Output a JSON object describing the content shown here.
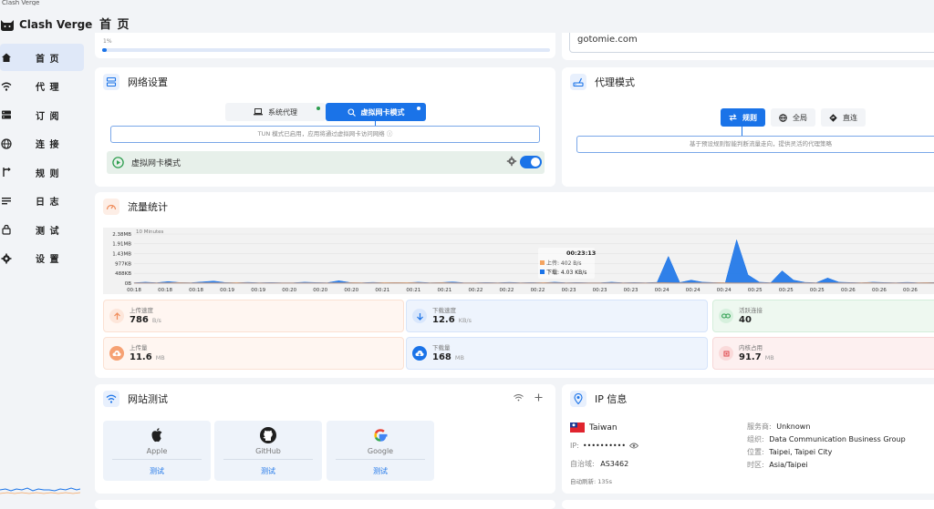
{
  "window": {
    "title": "Clash Verge"
  },
  "brand": {
    "name": "Clash Verge"
  },
  "header": {
    "title": "首 页"
  },
  "nav": [
    {
      "label": "首 页",
      "icon": "home-icon",
      "active": true
    },
    {
      "label": "代 理",
      "icon": "wifi-icon",
      "active": false
    },
    {
      "label": "订 阅",
      "icon": "subscription-icon",
      "active": false
    },
    {
      "label": "连 接",
      "icon": "globe-icon",
      "active": false
    },
    {
      "label": "规 则",
      "icon": "rules-icon",
      "active": false
    },
    {
      "label": "日 志",
      "icon": "log-icon",
      "active": false
    },
    {
      "label": "测 试",
      "icon": "lock-icon",
      "active": false
    },
    {
      "label": "设 置",
      "icon": "gear-icon",
      "active": false
    }
  ],
  "profile": {
    "progress_label": "1%",
    "progress": 0.01
  },
  "site": {
    "current": "gotomie.com"
  },
  "network": {
    "title": "网络设置",
    "system_proxy_label": "系统代理",
    "tun_label": "虚拟网卡模式",
    "hint": "TUN 模式已启用，应用将通过虚拟网卡访问网络 ⓘ",
    "tun_row_label": "虚拟网卡模式",
    "tun_enabled": true
  },
  "proxy_mode": {
    "title": "代理模式",
    "modes": [
      "规则",
      "全局",
      "直连"
    ],
    "active": "规则",
    "hint": "基于预设规则智能判断流量走向，提供灵活的代理策略"
  },
  "traffic": {
    "title": "流量统计",
    "range_label": "10 Minutes",
    "tooltip": {
      "time": "00:23:13",
      "up_label": "上传",
      "up_value": "402 B/s",
      "down_label": "下载",
      "down_value": "4.03 KB/s"
    },
    "stats": [
      {
        "title": "上传速度",
        "value": "786",
        "unit": "B/s",
        "icon": "arrow-up-icon"
      },
      {
        "title": "下载速度",
        "value": "12.6",
        "unit": "KB/s",
        "icon": "arrow-down-icon"
      },
      {
        "title": "活跃连接",
        "value": "40",
        "unit": "",
        "icon": "link-icon"
      },
      {
        "title": "上传量",
        "value": "11.6",
        "unit": "MB",
        "icon": "cloud-upload-icon"
      },
      {
        "title": "下载量",
        "value": "168",
        "unit": "MB",
        "icon": "cloud-download-icon"
      },
      {
        "title": "内核占用",
        "value": "91.7",
        "unit": "MB",
        "icon": "memory-icon"
      }
    ]
  },
  "chart_data": {
    "type": "area",
    "title": "10 Minutes",
    "y_ticks": [
      "2.38MB",
      "1.91MB",
      "1.43MB",
      "977KB",
      "488KB",
      "0B"
    ],
    "y_tick_values": [
      2.38,
      1.91,
      1.43,
      0.954,
      0.477,
      0
    ],
    "ylim": [
      0,
      2.38
    ],
    "x_ticks": [
      "00:18",
      "00:18",
      "00:18",
      "00:19",
      "00:19",
      "00:20",
      "00:20",
      "00:20",
      "00:21",
      "00:21",
      "00:21",
      "00:22",
      "00:22",
      "00:22",
      "00:23",
      "00:23",
      "00:23",
      "00:24",
      "00:24",
      "00:24",
      "00:25",
      "00:25",
      "00:25",
      "00:26",
      "00:26",
      "00:26",
      "00:27"
    ],
    "series": [
      {
        "name": "上传",
        "color": "#f4a460",
        "values": [
          0.01,
          0.01,
          0.01,
          0.02,
          0.01,
          0.01,
          0.01,
          0.02,
          0.01,
          0.01,
          0.01,
          0.01,
          0.01,
          0.01,
          0.01,
          0.02,
          0.01,
          0.02,
          0.02,
          0.02,
          0.01,
          0.02,
          0.01,
          0.01,
          0.01,
          0.01,
          0.01,
          0.01,
          0.02,
          0.01,
          0.01,
          0.01,
          0.01,
          0.01,
          0.01,
          0.01,
          0.02,
          0.01,
          0.01,
          0.01,
          0.02,
          0.01,
          0.01,
          0.01,
          0.01,
          0.01,
          0.01,
          0.01,
          0.01,
          0.01,
          0.02,
          0.01,
          0.01,
          0.01,
          0.02,
          0.01
        ]
      },
      {
        "name": "下载",
        "color": "#1a73e8",
        "values": [
          0.02,
          0.05,
          0.02,
          0.08,
          0.03,
          0.02,
          0.06,
          0.1,
          0.03,
          0.02,
          0.04,
          0.02,
          0.03,
          0.02,
          0.02,
          0.05,
          0.03,
          0.02,
          0.12,
          0.03,
          0.02,
          0.04,
          0.02,
          0.03,
          0.02,
          0.05,
          0.02,
          0.03,
          0.06,
          0.02,
          0.02,
          0.03,
          0.02,
          0.04,
          0.02,
          0.03,
          0.02,
          0.05,
          0.02,
          0.03,
          0.02,
          0.02,
          0.05,
          0.02,
          0.03,
          0.02,
          0.04,
          1.3,
          0.03,
          0.15,
          0.05,
          0.03,
          0.02,
          2.1,
          0.4,
          0.05,
          0.02,
          0.6,
          0.15,
          0.04,
          0.02,
          0.25,
          0.05,
          0.03,
          0.02,
          0.05,
          0.03,
          0.02,
          0.04,
          0.02,
          0.03,
          0.04
        ]
      }
    ]
  },
  "site_test": {
    "title": "网站测试",
    "items": [
      {
        "name": "Apple",
        "button": "测试",
        "icon": "apple-icon"
      },
      {
        "name": "GitHub",
        "button": "测试",
        "icon": "github-icon"
      },
      {
        "name": "Google",
        "button": "测试",
        "icon": "google-icon"
      }
    ]
  },
  "ip_info": {
    "title": "IP 信息",
    "country": "Taiwan",
    "ip_label": "IP:",
    "ip_value": "••••••••••",
    "asn_label": "自治域:",
    "asn_value": "AS3462",
    "refresh": "自动刷新: 135s",
    "provider_label": "服务商:",
    "provider_value": "Unknown",
    "org_label": "组织:",
    "org_value": "Data Communication Business Group",
    "location_label": "位置:",
    "location_value": "Taipei, Taipei City",
    "tz_label": "时区:",
    "tz_value": "Asia/Taipei"
  },
  "colors": {
    "accent": "#1a73e8",
    "tun_active_bg": "#e7f0ea",
    "upload": "#f4a460",
    "download": "#1a73e8"
  }
}
